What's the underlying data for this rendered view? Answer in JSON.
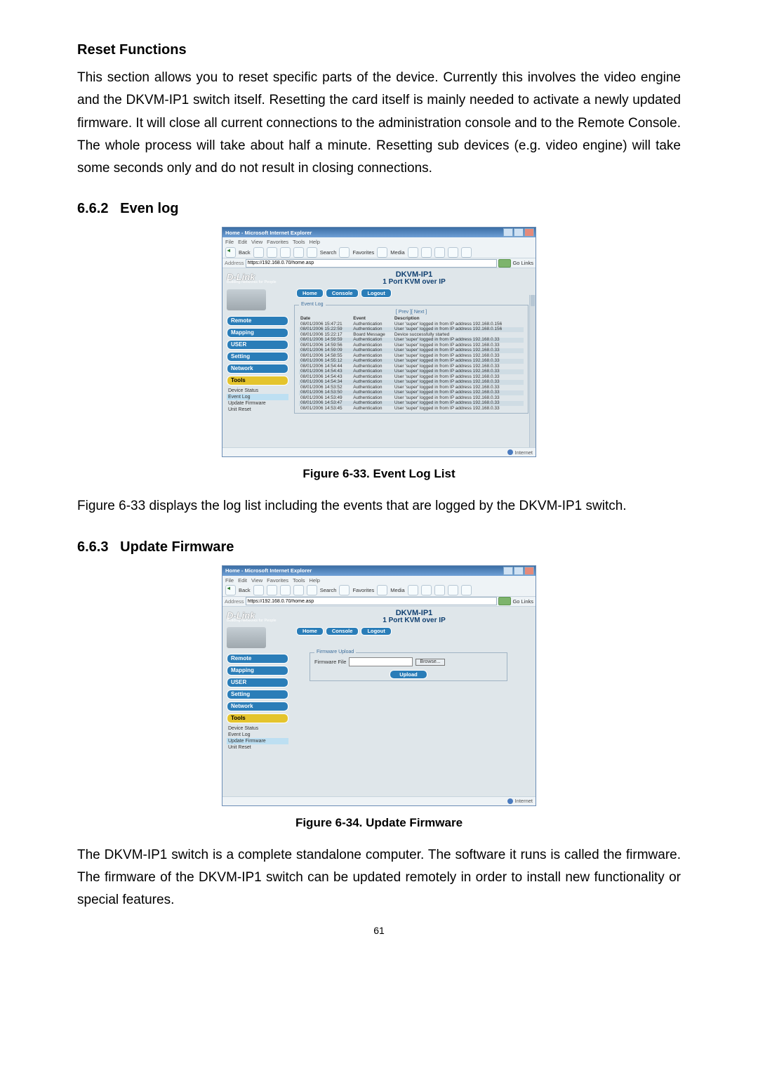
{
  "headings": {
    "reset": "Reset Functions",
    "evenlog_num": "6.6.2",
    "evenlog": "Even log",
    "updatefw_num": "6.6.3",
    "updatefw": "Update Firmware"
  },
  "paragraphs": {
    "reset": "This section allows you to reset specific parts of the device. Currently this involves the video engine and the DKVM-IP1 switch itself. Resetting the card itself is mainly needed to activate a newly updated firmware. It will close all current connections to the administration console and to the Remote Console. The whole process will take about half a minute. Resetting sub devices (e.g. video engine) will take some seconds only and do not result in closing connections.",
    "fig633_desc": "Figure 6-33 displays the log list including the events that are logged by the DKVM-IP1 switch.",
    "fig634_desc": "The DKVM-IP1 switch is a complete standalone computer. The software it runs is called the firmware. The firmware of the DKVM-IP1 switch can be updated remotely in order to install new functionality or special features."
  },
  "captions": {
    "fig633": "Figure 6-33. Event Log List",
    "fig634": "Figure 6-34. Update Firmware"
  },
  "page_number": "61",
  "ie": {
    "title": "Home - Microsoft Internet Explorer",
    "menu": [
      "File",
      "Edit",
      "View",
      "Favorites",
      "Tools",
      "Help"
    ],
    "toolbar": {
      "back": "Back",
      "search": "Search",
      "favorites": "Favorites",
      "media": "Media"
    },
    "address_label": "Address",
    "address_url": "https://192.168.0.70/home.asp",
    "go": "Go",
    "links": "Links",
    "status": "Internet"
  },
  "dlink": {
    "logo": "D-Link",
    "logo_sub": "Building Networks for People",
    "model": "DKVM-IP1",
    "subtitle": "1 Port KVM over IP",
    "tabs": [
      "Home",
      "Console",
      "Logout"
    ],
    "side_buttons": [
      "Remote",
      "Mapping",
      "USER",
      "Setting",
      "Network",
      "Tools"
    ],
    "tools_sub_eventlog": [
      "Device Status",
      "Event Log",
      "Update Firmware",
      "Unit Reset"
    ],
    "tools_sub_updatefw": [
      "Device Status",
      "Event Log",
      "Update Firmware",
      "Unit Reset"
    ],
    "tools_hl_eventlog": 1,
    "tools_hl_updatefw": 2
  },
  "eventlog": {
    "panel_title": "Event Log",
    "prevnext": "[ Prev ][ Next ]",
    "headers": [
      "Date",
      "Event",
      "Description"
    ],
    "rows": [
      {
        "d": "08/01/2006 15:47:21",
        "e": "Authentication",
        "m": "User 'super' logged in from IP address 192.168.0.156"
      },
      {
        "d": "08/01/2006 15:22:59",
        "e": "Authentication",
        "m": "User 'super' logged in from IP address 192.168.0.156"
      },
      {
        "d": "08/01/2006 15:22:17",
        "e": "Board Message",
        "m": "Device successfully started"
      },
      {
        "d": "08/01/2006 14:59:59",
        "e": "Authentication",
        "m": "User 'super' logged in from IP address 192.168.0.33"
      },
      {
        "d": "08/01/2006 14:59:56",
        "e": "Authentication",
        "m": "User 'super' logged in from IP address 192.168.0.33"
      },
      {
        "d": "08/01/2006 14:59:09",
        "e": "Authentication",
        "m": "User 'super' logged in from IP address 192.168.0.33"
      },
      {
        "d": "08/01/2006 14:58:55",
        "e": "Authentication",
        "m": "User 'super' logged in from IP address 192.168.0.33"
      },
      {
        "d": "08/01/2006 14:55:12",
        "e": "Authentication",
        "m": "User 'super' logged in from IP address 192.168.0.33"
      },
      {
        "d": "08/01/2006 14:54:44",
        "e": "Authentication",
        "m": "User 'super' logged in from IP address 192.168.0.33"
      },
      {
        "d": "08/01/2006 14:54:43",
        "e": "Authentication",
        "m": "User 'super' logged in from IP address 192.168.0.33"
      },
      {
        "d": "08/01/2006 14:54:43",
        "e": "Authentication",
        "m": "User 'super' logged in from IP address 192.168.0.33"
      },
      {
        "d": "08/01/2006 14:54:34",
        "e": "Authentication",
        "m": "User 'super' logged in from IP address 192.168.0.33"
      },
      {
        "d": "08/01/2006 14:53:52",
        "e": "Authentication",
        "m": "User 'super' logged in from IP address 192.168.0.33"
      },
      {
        "d": "08/01/2006 14:53:50",
        "e": "Authentication",
        "m": "User 'super' logged in from IP address 192.168.0.33"
      },
      {
        "d": "08/01/2006 14:53:49",
        "e": "Authentication",
        "m": "User 'super' logged in from IP address 192.168.0.33"
      },
      {
        "d": "08/01/2006 14:53:47",
        "e": "Authentication",
        "m": "User 'super' logged in from IP address 192.168.0.33"
      },
      {
        "d": "08/01/2006 14:53:45",
        "e": "Authentication",
        "m": "User 'super' logged in from IP address 192.168.0.33"
      }
    ]
  },
  "firmware": {
    "panel_title": "Firmware Upload",
    "file_label": "Firmware File",
    "browse": "Browse...",
    "upload": "Upload"
  }
}
